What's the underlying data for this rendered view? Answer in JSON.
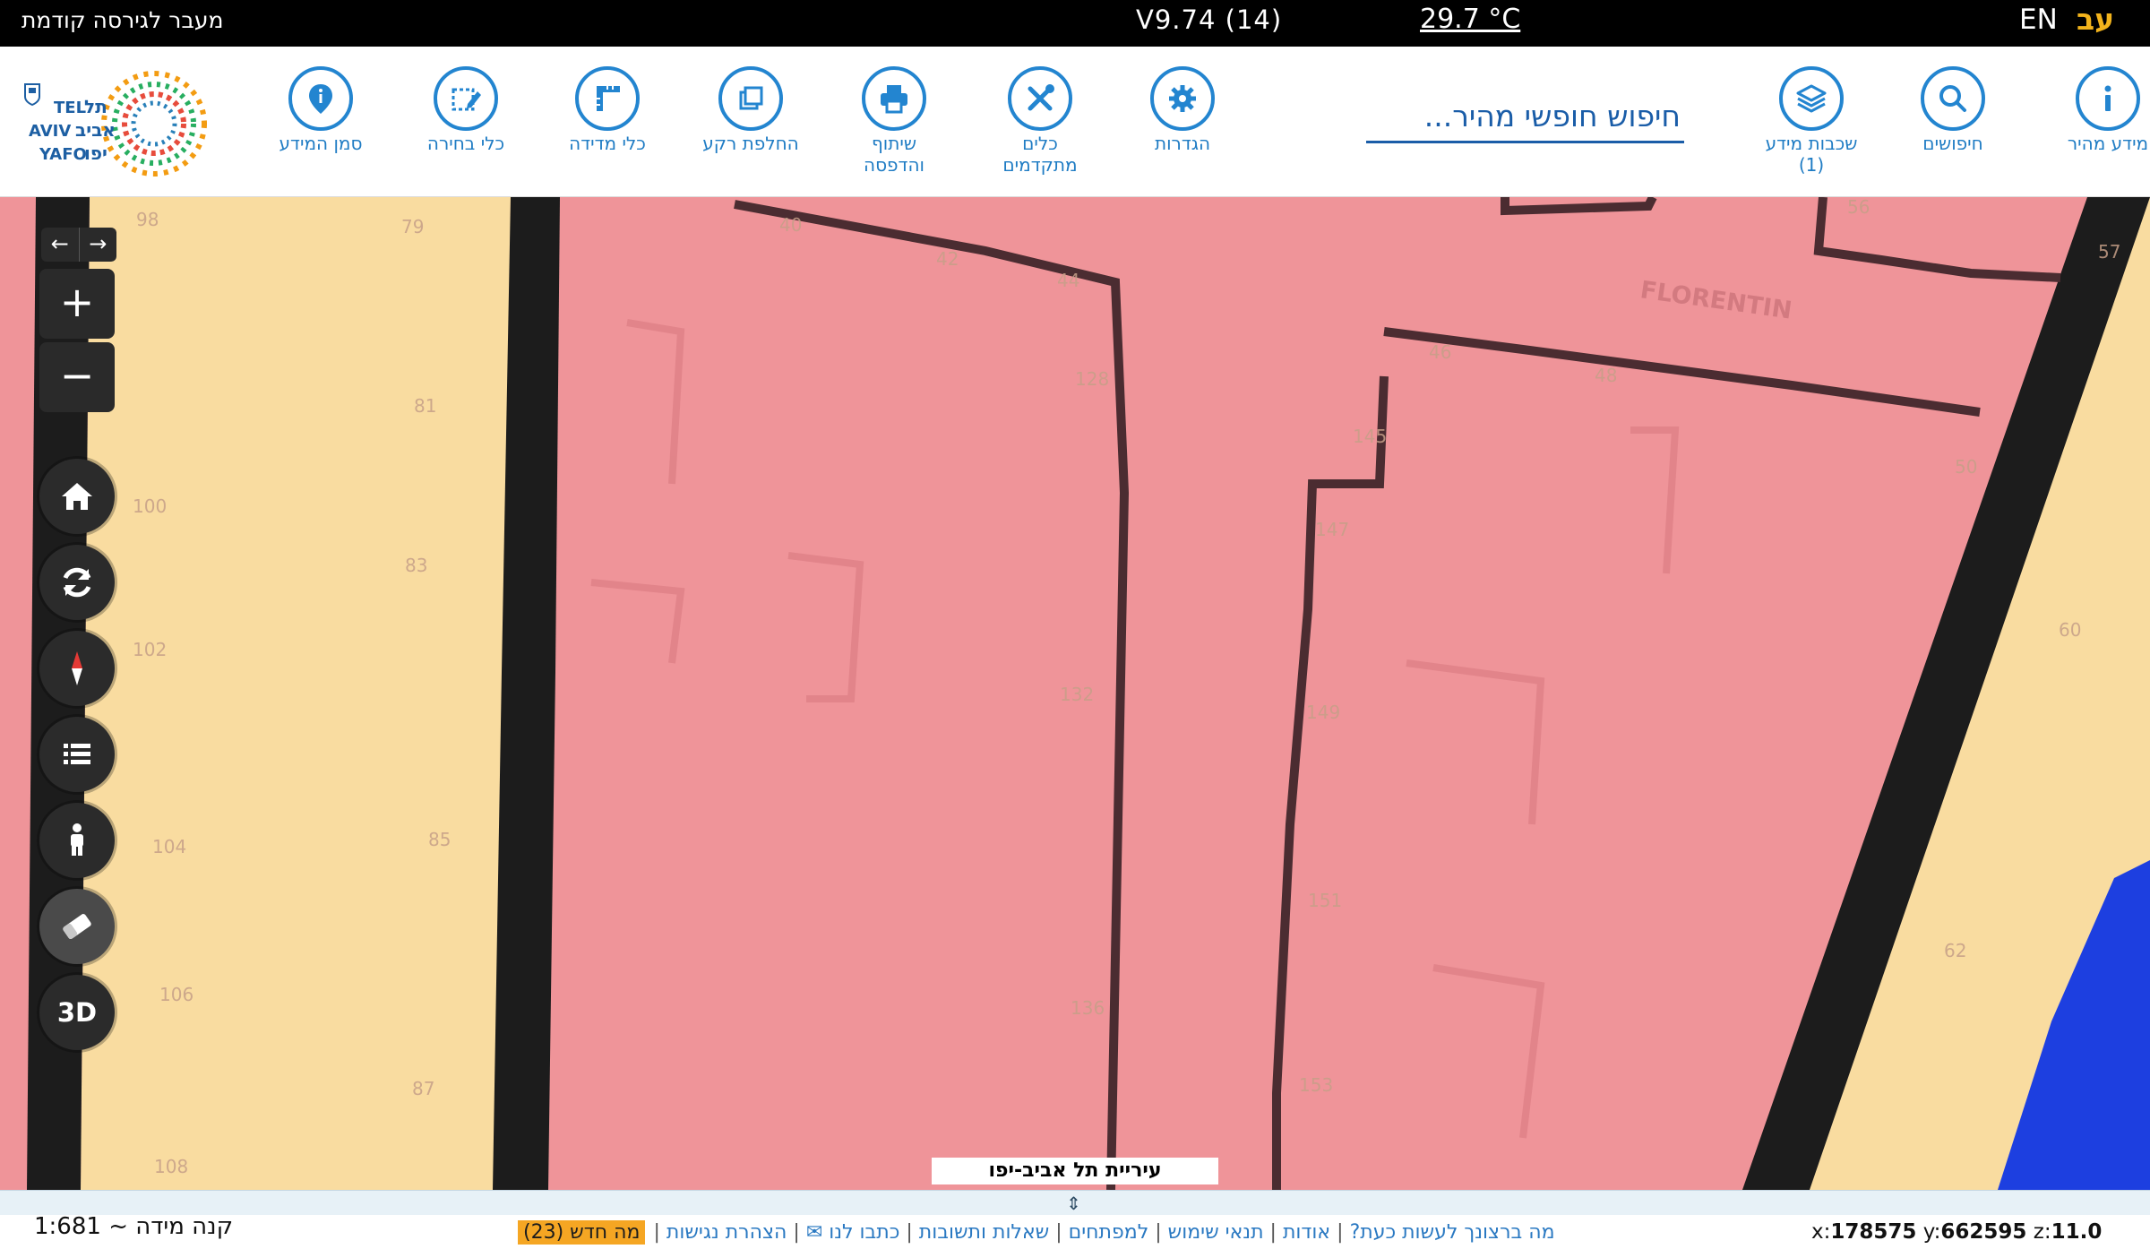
{
  "top_bar": {
    "prev_version_link": "מעבר לגירסה קודמת",
    "version": "V9.74 (14)",
    "temperature": "29.7 °C",
    "lang_en": "EN",
    "lang_he": "עב"
  },
  "toolbar": {
    "quick_info": "מידע מהיר",
    "searches": "חיפושים",
    "info_layers": "שכבות מידע",
    "info_layers_count": "(1)",
    "search_placeholder": "חיפוש חופשי מהיר...",
    "settings": "הגדרות",
    "advanced_tools_line1": "כלים",
    "advanced_tools_line2": "מתקדמים",
    "share_print_line1": "שיתוף",
    "share_print_line2": "והדפסה",
    "switch_background": "החלפת רקע",
    "measure_tools": "כלי מדידה",
    "selection_tools": "כלי בחירה",
    "info_marker": "סמן המידע"
  },
  "logo": {
    "text_en": "TEL AVIV YAFO",
    "text_he": "תל אביב יפו"
  },
  "map": {
    "street_label_florentin": "FLORENTIN",
    "house_numbers": [
      "98",
      "79",
      "81",
      "100",
      "83",
      "102",
      "85",
      "104",
      "106",
      "87",
      "108",
      "40",
      "42",
      "44",
      "128",
      "132",
      "136",
      "56",
      "57",
      "46",
      "48",
      "145",
      "147",
      "149",
      "151",
      "153",
      "50",
      "60",
      "62"
    ],
    "city_label": "עיריית תל אביב-יפו",
    "three_d_label": "3D",
    "colors": {
      "pink_zone": "#ef9499",
      "yellow_zone": "#f9dca0",
      "road_outline": "#1c1c1c",
      "water": "#1d3fe0"
    }
  },
  "footer": {
    "scale": "קנה מידה ~ 1:681",
    "links": {
      "whats_new": "מה חדש",
      "whats_new_count": "(23)",
      "accessibility": "הצהרת נגישות",
      "contact": "כתבו לנו ✉",
      "faq": "שאלות ותשובות",
      "developers": "למפתחים",
      "terms": "תנאי שימוש",
      "about": "אודות",
      "what_to_do": "מה ברצונך לעשות כעת?"
    },
    "coords": {
      "x_label": "x:",
      "x_value": "178575",
      "y_label": "y:",
      "y_value": "662595",
      "z_label": "z:",
      "z_value": "11.0"
    }
  }
}
